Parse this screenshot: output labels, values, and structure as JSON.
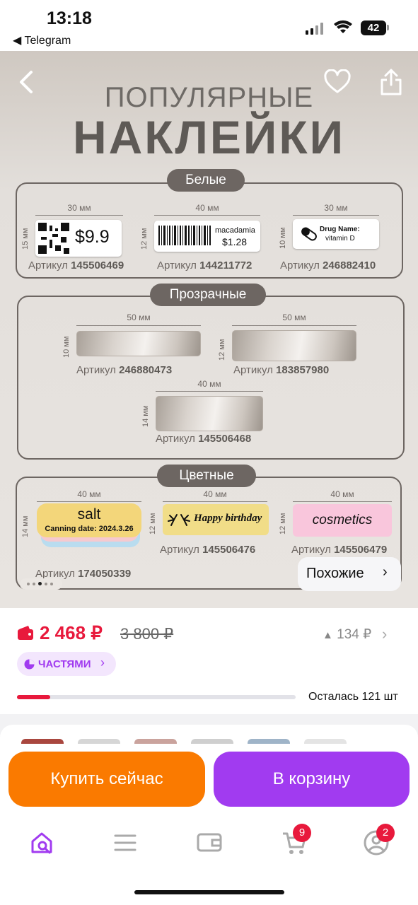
{
  "status": {
    "time": "13:18",
    "back_app": "◀ Telegram",
    "battery": "42"
  },
  "hero": {
    "title_line1": "ПОПУЛЯРНЫЕ",
    "title_line2": "НАКЛЕЙКИ",
    "sections": [
      {
        "title": "Белые",
        "items": [
          {
            "width": "30 мм",
            "height": "15 мм",
            "article_prefix": "Артикул",
            "article": "145506469",
            "text": "$9.9"
          },
          {
            "width": "40 мм",
            "height": "12 мм",
            "article_prefix": "Артикул",
            "article": "144211772",
            "text": "macadamia",
            "text2": "$1.28"
          },
          {
            "width": "30 мм",
            "height": "10 мм",
            "article_prefix": "Артикул",
            "article": "246882410",
            "text": "Drug Name:",
            "text2": "vitamin D"
          }
        ]
      },
      {
        "title": "Прозрачные",
        "items": [
          {
            "width": "50 мм",
            "height": "10 мм",
            "article_prefix": "Артикул",
            "article": "246880473"
          },
          {
            "width": "50 мм",
            "height": "12 мм",
            "article_prefix": "Артикул",
            "article": "183857980"
          },
          {
            "width": "40 мм",
            "height": "14 мм",
            "article_prefix": "Артикул",
            "article": "145506468"
          }
        ]
      },
      {
        "title": "Цветные",
        "items": [
          {
            "width": "40 мм",
            "height": "14 мм",
            "article_prefix": "Артикул",
            "article": "174050339",
            "text": "salt",
            "text2": "Canning date: 2024.3.26"
          },
          {
            "width": "40 мм",
            "height": "12 мм",
            "article_prefix": "Артикул",
            "article": "145506476",
            "text": "Happy birthday"
          },
          {
            "width": "40 мм",
            "height": "12 мм",
            "article_prefix": "Артикул",
            "article": "145506479",
            "text": "cosmetics"
          }
        ]
      }
    ],
    "similar_label": "Похожие"
  },
  "price": {
    "current": "2 468 ₽",
    "old": "3 800 ₽",
    "change": "134 ₽",
    "installments": "ЧАСТЯМИ",
    "stock_text": "Осталась 121 шт",
    "stock_progress": 0.12
  },
  "actions": {
    "buy_now": "Купить сейчас",
    "to_cart": "В корзину"
  },
  "nav": {
    "cart_badge": "9",
    "profile_badge": "2"
  },
  "colors": {
    "accent_pink": "#e8193c",
    "buy_orange": "#fa7a00",
    "cart_purple": "#a13bf0"
  }
}
